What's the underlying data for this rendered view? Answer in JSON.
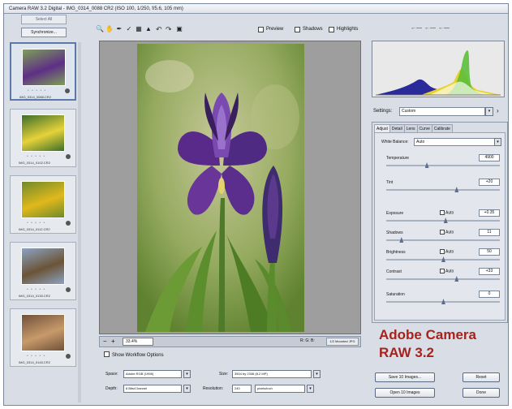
{
  "window": {
    "title": "Camera RAW 3.2 Digital - IMG_0314_0088 CR2 (ISO 100, 1/250, f/5.6, 105 mm)"
  },
  "filmstrip": {
    "select_all_label": "Select All",
    "synchronize_label": "Synchronize...",
    "thumbnails": [
      {
        "filename": "IMG_0314_0088.CR2",
        "stars": "• • • • •",
        "selected": true,
        "colors": [
          "#7ea057",
          "#5d2f86"
        ]
      },
      {
        "filename": "IMG_0314_0102.CR2",
        "stars": "• • • • •",
        "selected": false,
        "colors": [
          "#3c6e2a",
          "#e6d23a"
        ]
      },
      {
        "filename": "IMG_0314_0112.CR2",
        "stars": "• • • • •",
        "selected": false,
        "colors": [
          "#6f8a2a",
          "#e0b81c"
        ]
      },
      {
        "filename": "IMG_0314_0130.CR2",
        "stars": "• • • • •",
        "selected": false,
        "colors": [
          "#8ca3c2",
          "#6b5437"
        ]
      },
      {
        "filename": "IMG_0314_0145.CR2",
        "stars": "• • • • •",
        "selected": false,
        "colors": [
          "#70513a",
          "#c89a6a"
        ]
      }
    ]
  },
  "toolbar": {
    "preview_label": "Preview",
    "shadows_label": "Shadows",
    "highlights_label": "Highlights",
    "rotate_left": "↶",
    "rotate_right": "↷"
  },
  "statusbar": {
    "zoom_value": "33.4%",
    "rgb_label": "R: G: B:",
    "coords": "1/2 Mounted JPG"
  },
  "workflow": {
    "show_label": "Show Workflow Options",
    "space_label": "Space:",
    "space_value": "Adobe RGB (1998)",
    "depth_label": "Depth:",
    "depth_value": "8 Bits/Channel",
    "size_label": "Size:",
    "size_value": "3504 by 2336 (8.2 MP)",
    "resolution_label": "Resolution:",
    "resolution_value": "240",
    "resolution_unit": "pixels/inch"
  },
  "settings": {
    "label": "Settings:",
    "value": "Custom"
  },
  "tabs": [
    "Adjust",
    "Detail",
    "Lens",
    "Curve",
    "Calibrate"
  ],
  "adjust": {
    "wb_label": "White Balance:",
    "wb_value": "Auto",
    "auto_label": "Auto",
    "rows": [
      {
        "name": "Temperature",
        "value": "4900",
        "auto": false,
        "level": 0.35
      },
      {
        "name": "Tint",
        "value": "+20",
        "auto": false,
        "level": 0.62
      },
      {
        "name": "Exposure",
        "value": "+0.35",
        "auto": true,
        "level": 0.52
      },
      {
        "name": "Shadows",
        "value": "11",
        "auto": true,
        "level": 0.12
      },
      {
        "name": "Brightness",
        "value": "50",
        "auto": true,
        "level": 0.5
      },
      {
        "name": "Contrast",
        "value": "+33",
        "auto": true,
        "level": 0.62
      },
      {
        "name": "Saturation",
        "value": "0",
        "auto": false,
        "level": 0.5
      }
    ]
  },
  "buttons": {
    "save": "Save 10 Images...",
    "reset": "Reset",
    "open": "Open 10 Images",
    "done": "Done"
  },
  "caption": {
    "line1": "Adobe Camera",
    "line2": "RAW 3.2"
  }
}
